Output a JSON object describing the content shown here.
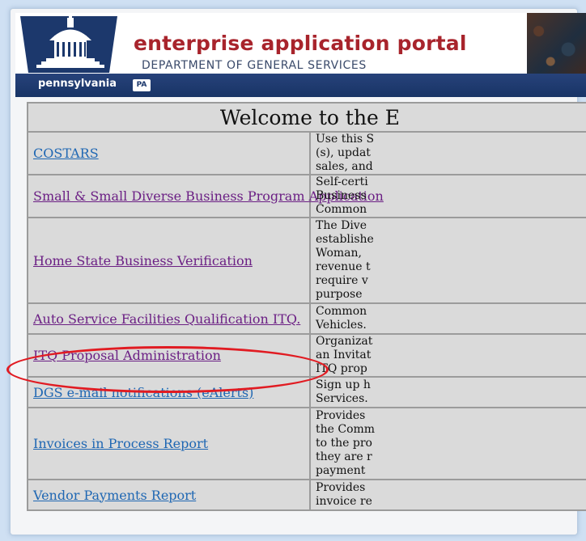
{
  "header": {
    "title": "enterprise application portal",
    "department": "DEPARTMENT OF GENERAL SERVICES",
    "state_label": "pennsylvania",
    "state_badge": "PA"
  },
  "table": {
    "welcome": "Welcome to the E",
    "rows": [
      {
        "label": "COSTARS",
        "desc": [
          "Use this S",
          "(s), updat",
          "sales, and"
        ]
      },
      {
        "label": "Small & Small Diverse Business Program Application",
        "desc": [
          "Self-certi",
          "Business",
          "Common"
        ]
      },
      {
        "label": "Home State Business Verification",
        "desc": [
          "The Dive",
          "establishe",
          "Woman,",
          "revenue t",
          "require v",
          "purpose"
        ]
      },
      {
        "label": "Auto Service Facilities Qualification ITQ.",
        "desc": [
          "Common",
          "Vehicles."
        ]
      },
      {
        "label": "ITQ Proposal Administration",
        "desc": [
          "Organizat",
          "an Invitat",
          "ITQ prop"
        ]
      },
      {
        "label": "DGS e-mail notifications (eAlerts)",
        "desc": [
          "Sign up h",
          "Services."
        ]
      },
      {
        "label": "Invoices in Process Report",
        "desc": [
          "Provides",
          "the Comm",
          "to the pro",
          "they are r",
          "payment"
        ]
      },
      {
        "label": "Vendor Payments Report",
        "desc": [
          "Provides",
          "invoice re"
        ]
      }
    ]
  },
  "colors": {
    "title_red": "#a8242c",
    "link_blue": "#1f67b3",
    "link_visited_purple": "#6b1f84",
    "nav_bar": "#1c386c",
    "highlight_red": "#e11b22"
  }
}
